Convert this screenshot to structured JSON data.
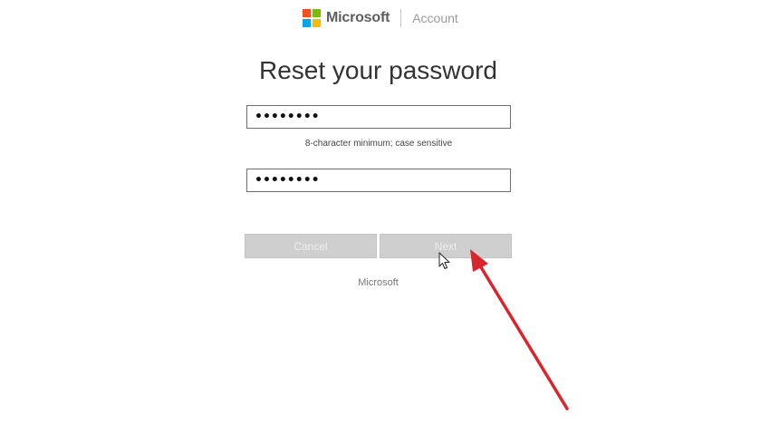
{
  "header": {
    "brand": "Microsoft",
    "section": "Account",
    "logo_colors": [
      "#f25022",
      "#7fba00",
      "#00a4ef",
      "#ffb900"
    ]
  },
  "title": "Reset your password",
  "form": {
    "new_password_value": "••••••••",
    "hint": "8-character minimum; case sensitive",
    "confirm_password_value": "••••••••"
  },
  "buttons": {
    "cancel": "Cancel",
    "next": "Next"
  },
  "footer": "Microsoft",
  "annotation": {
    "arrow_color": "#d9262c",
    "pointer_icon": "mouse-pointer-icon"
  }
}
